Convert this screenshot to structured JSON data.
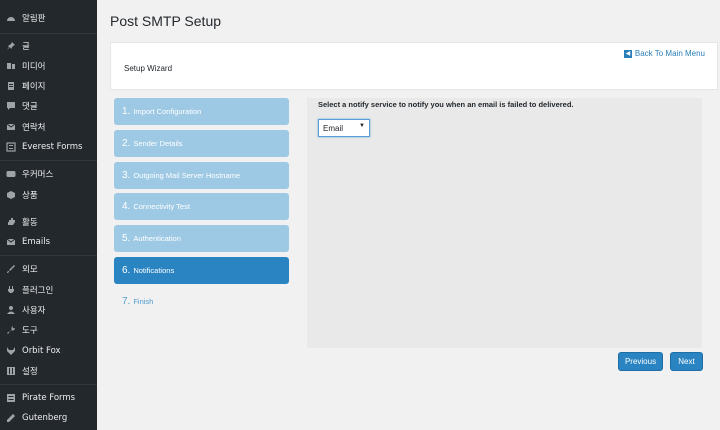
{
  "sidebar": {
    "items": [
      {
        "label": "알림판",
        "icon": "dashboard-icon"
      },
      {
        "label": "글",
        "icon": "pin-icon"
      },
      {
        "label": "미디어",
        "icon": "media-icon"
      },
      {
        "label": "페이지",
        "icon": "page-icon"
      },
      {
        "label": "댓글",
        "icon": "comment-icon"
      },
      {
        "label": "연락처",
        "icon": "mail-icon"
      },
      {
        "label": "Everest Forms",
        "icon": "form-icon"
      },
      {
        "label": "우커머스",
        "icon": "woo-icon"
      },
      {
        "label": "상품",
        "icon": "box-icon"
      },
      {
        "label": "활동",
        "icon": "hand-icon"
      },
      {
        "label": "Emails",
        "icon": "envelope-icon"
      },
      {
        "label": "외모",
        "icon": "brush-icon"
      },
      {
        "label": "플러그인",
        "icon": "plug-icon"
      },
      {
        "label": "사용자",
        "icon": "user-icon"
      },
      {
        "label": "도구",
        "icon": "wrench-icon"
      },
      {
        "label": "Orbit Fox",
        "icon": "fox-icon"
      },
      {
        "label": "설정",
        "icon": "settings-icon"
      },
      {
        "label": "Pirate Forms",
        "icon": "list-icon"
      },
      {
        "label": "Gutenberg",
        "icon": "pen-icon"
      }
    ]
  },
  "page": {
    "title": "Post SMTP Setup",
    "wizard_title": "Setup Wizard",
    "back_link": "Back To Main Menu"
  },
  "steps": [
    {
      "num": "1.",
      "label": "Import Configuration",
      "state": "done"
    },
    {
      "num": "2.",
      "label": "Sender Details",
      "state": "done"
    },
    {
      "num": "3.",
      "label": "Outgoing Mail Server Hostname",
      "state": "done"
    },
    {
      "num": "4.",
      "label": "Connectivity Test",
      "state": "done"
    },
    {
      "num": "5.",
      "label": "Authentication",
      "state": "done"
    },
    {
      "num": "6.",
      "label": "Notifications",
      "state": "active"
    },
    {
      "num": "7.",
      "label": "Finish",
      "state": "pending"
    }
  ],
  "notify": {
    "prompt": "Select a notify service to notify you when an email is failed to delivered.",
    "selected": "Email"
  },
  "buttons": {
    "previous": "Previous",
    "next": "Next"
  },
  "colors": {
    "accent": "#2a84c2",
    "step_done": "#9ec9e4",
    "sidebar_bg": "#23282d"
  }
}
